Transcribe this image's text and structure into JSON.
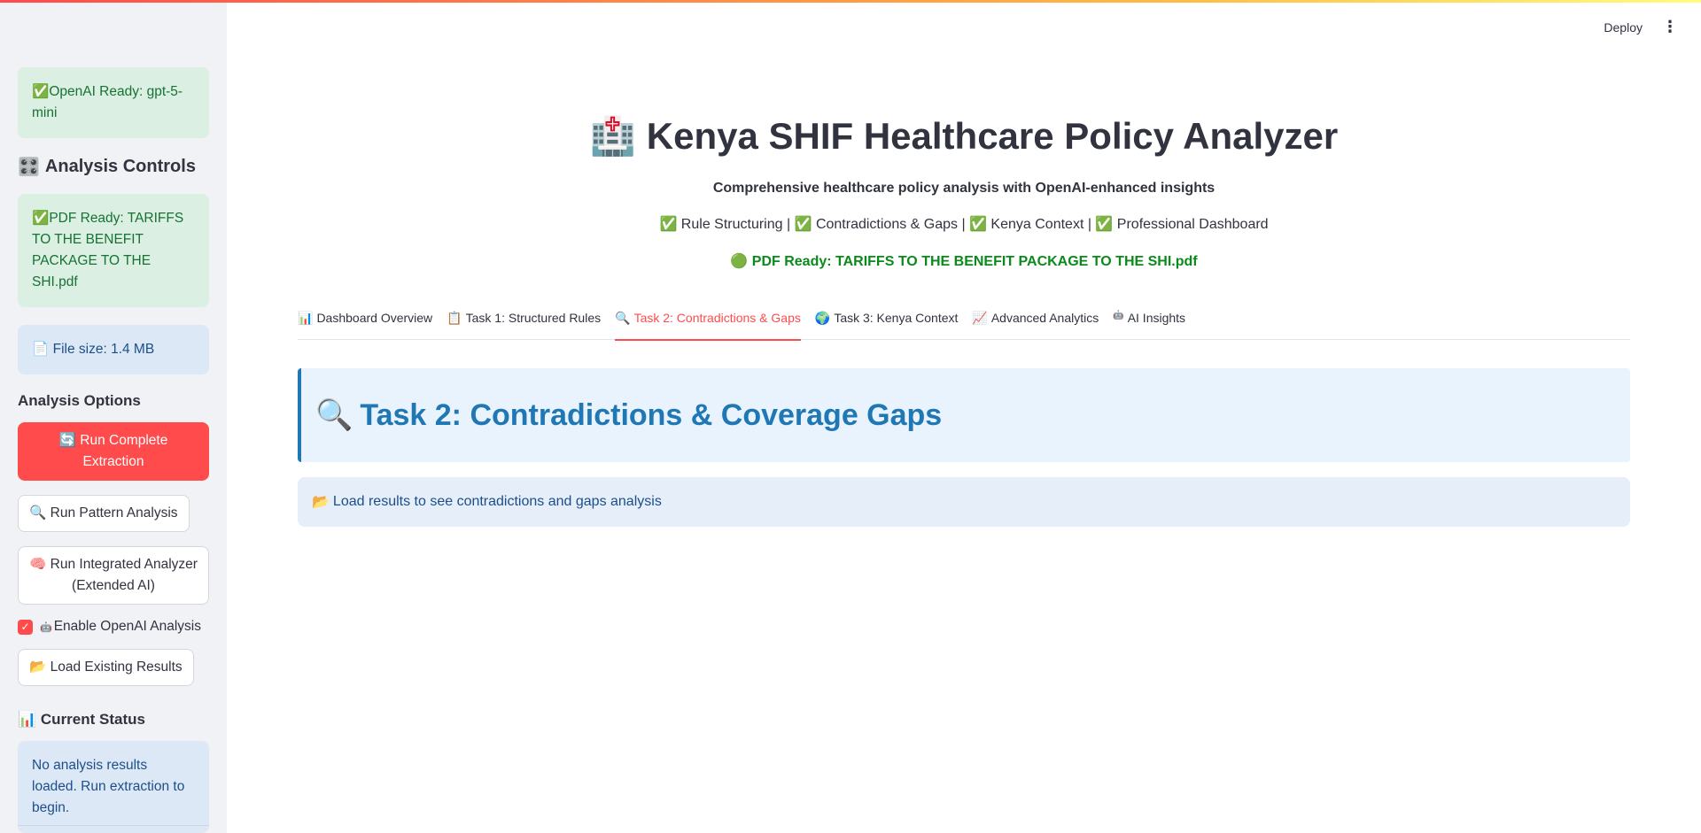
{
  "header": {
    "deploy_label": "Deploy",
    "menu_icon": "⋮"
  },
  "sidebar": {
    "openai_status": {
      "icon": "✅",
      "text": "OpenAI Ready: gpt-5-mini"
    },
    "analysis_controls": {
      "icon": "🎛️",
      "title": "Analysis Controls"
    },
    "pdf_status": {
      "icon": "✅",
      "text": "PDF Ready: TARIFFS TO THE BENEFIT PACKAGE TO THE SHI.pdf"
    },
    "file_size": {
      "icon": "📄",
      "text": "File size: 1.4 MB"
    },
    "analysis_options_title": "Analysis Options",
    "buttons": {
      "run_complete": {
        "icon": "🔄",
        "label": "Run Complete Extraction"
      },
      "run_pattern": {
        "icon": "🔍",
        "label": "Run Pattern Analysis"
      },
      "run_integrated": {
        "icon": "🧠",
        "label": "Run Integrated Analyzer (Extended AI)"
      },
      "load_existing": {
        "icon": "📂",
        "label": "Load Existing Results"
      }
    },
    "enable_openai": {
      "checked": true,
      "icon": "🤖",
      "label": "Enable OpenAI Analysis"
    },
    "current_status": {
      "icon": "📊",
      "title": "Current Status"
    },
    "status_message": "No analysis results loaded. Run extraction to begin."
  },
  "main": {
    "title": {
      "icon": "🏥",
      "text": "Kenya SHIF Healthcare Policy Analyzer"
    },
    "subtitle": "Comprehensive healthcare policy analysis with OpenAI-enhanced insights",
    "features": "✅ Rule Structuring | ✅ Contradictions & Gaps | ✅ Kenya Context | ✅ Professional Dashboard",
    "pdf_ready": {
      "icon": "🟢",
      "text": "PDF Ready: TARIFFS TO THE BENEFIT PACKAGE TO THE SHI.pdf"
    },
    "tabs": [
      {
        "icon": "📊",
        "label": "Dashboard Overview"
      },
      {
        "icon": "📋",
        "label": "Task 1: Structured Rules"
      },
      {
        "icon": "🔍",
        "label": "Task 2: Contradictions & Gaps"
      },
      {
        "icon": "🌍",
        "label": "Task 3: Kenya Context"
      },
      {
        "icon": "📈",
        "label": "Advanced Analytics"
      },
      {
        "icon": "🤖",
        "label": "AI Insights"
      }
    ],
    "active_tab": "Task 2: Contradictions & Gaps",
    "section": {
      "icon": "🔍",
      "title": "Task 2: Contradictions & Coverage Gaps"
    },
    "info": {
      "icon": "📂",
      "text": "Load results to see contradictions and gaps analysis"
    }
  },
  "colors": {
    "accent": "#ff4b4b",
    "section_blue": "#1f77b4",
    "success_green": "#0b8a1b"
  }
}
